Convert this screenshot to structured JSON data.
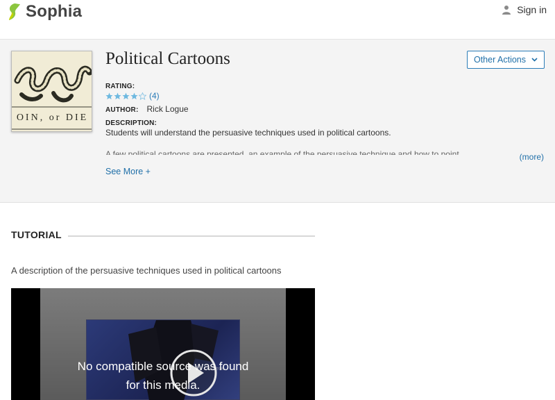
{
  "header": {
    "logo_text": "Sophia",
    "signin_label": "Sign in",
    "brand_color": "#8cc63f"
  },
  "overview": {
    "title": "Political Cartoons",
    "thumbnail_caption": "OIN, or DIE",
    "other_actions_label": "Other Actions",
    "rating_label": "RATING:",
    "rating_value": 4,
    "rating_max": 5,
    "rating_count": "(4)",
    "author_label": "AUTHOR:",
    "author_name": "Rick Logue",
    "description_label": "DESCRIPTION:",
    "description": "Students will understand the persuasive techniques used in political cartoons.",
    "description_continued": "A few political cartoons are presented, an example of the persuasive technique and how to point",
    "more_label": "(more)",
    "see_more_label": "See More +",
    "link_color": "#1f6fa8"
  },
  "tutorial": {
    "section_title": "TUTORIAL",
    "description": "A description of the persuasive techniques used in political cartoons",
    "video_message_line1": "No compatible source was found",
    "video_message_line2": "for this media."
  }
}
